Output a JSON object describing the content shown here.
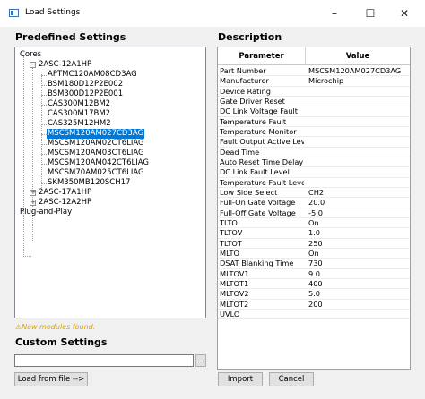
{
  "window": {
    "title": "Load Settings",
    "minimize": "–",
    "maximize": "☐",
    "close": "✕"
  },
  "left": {
    "predefined_title": "Predefined Settings",
    "tree": {
      "root": "Cores",
      "group1": "2ASC-12A1HP",
      "group1_items": [
        "APTMC120AM08CD3AG",
        "BSM180D12P2E002",
        "BSM300D12P2E001",
        "CAS300M12BM2",
        "CAS300M17BM2",
        "CAS325M12HM2",
        "MSCSM120AM027CD3AG",
        "MSCSM120AM02CT6LIAG",
        "MSCSM120AM03CT6LIAG",
        "MSCSM120AM042CT6LIAG",
        "MSCSM70AM025CT6LIAG",
        "SKM350MB120SCH17"
      ],
      "selected_index": 6,
      "group2": "2ASC-17A1HP",
      "group3": "2ASC-12A2HP",
      "plug_and_play": "Plug-and-Play"
    },
    "notice": "New modules found.",
    "custom_title": "Custom Settings",
    "custom_input_value": "",
    "browse_label": "...",
    "load_button": "Load from file -->"
  },
  "right": {
    "description_title": "Description",
    "grid_headers": {
      "parameter": "Parameter",
      "value": "Value"
    },
    "rows": [
      {
        "p": "Part Number",
        "v": "MSCSM120AM027CD3AG"
      },
      {
        "p": "Manufacturer",
        "v": "Microchip"
      },
      {
        "p": "Device Rating",
        "v": ""
      },
      {
        "p": "Gate Driver Reset",
        "v": ""
      },
      {
        "p": "DC Link Voltage Fault",
        "v": ""
      },
      {
        "p": "Temperature Fault",
        "v": ""
      },
      {
        "p": "Temperature Monitor",
        "v": ""
      },
      {
        "p": "Fault Output Active Level",
        "v": ""
      },
      {
        "p": "Dead Time",
        "v": ""
      },
      {
        "p": "Auto Reset Time Delay",
        "v": ""
      },
      {
        "p": "DC Link Fault Level",
        "v": ""
      },
      {
        "p": "Temperature Fault Level",
        "v": ""
      },
      {
        "p": "Low Side Select",
        "v": "CH2"
      },
      {
        "p": "Full-On Gate Voltage",
        "v": "20.0"
      },
      {
        "p": "Full-Off Gate Voltage",
        "v": "-5.0"
      },
      {
        "p": "TLTO",
        "v": "On"
      },
      {
        "p": "TLTOV",
        "v": "1.0"
      },
      {
        "p": "TLTOT",
        "v": "250"
      },
      {
        "p": "MLTO",
        "v": "On"
      },
      {
        "p": "DSAT Blanking Time",
        "v": "730"
      },
      {
        "p": "MLTOV1",
        "v": "9.0"
      },
      {
        "p": "MLTOT1",
        "v": "400"
      },
      {
        "p": "MLTOV2",
        "v": "5.0"
      },
      {
        "p": "MLTOT2",
        "v": "200"
      },
      {
        "p": "UVLO",
        "v": ""
      }
    ],
    "import_button": "Import",
    "cancel_button": "Cancel"
  }
}
